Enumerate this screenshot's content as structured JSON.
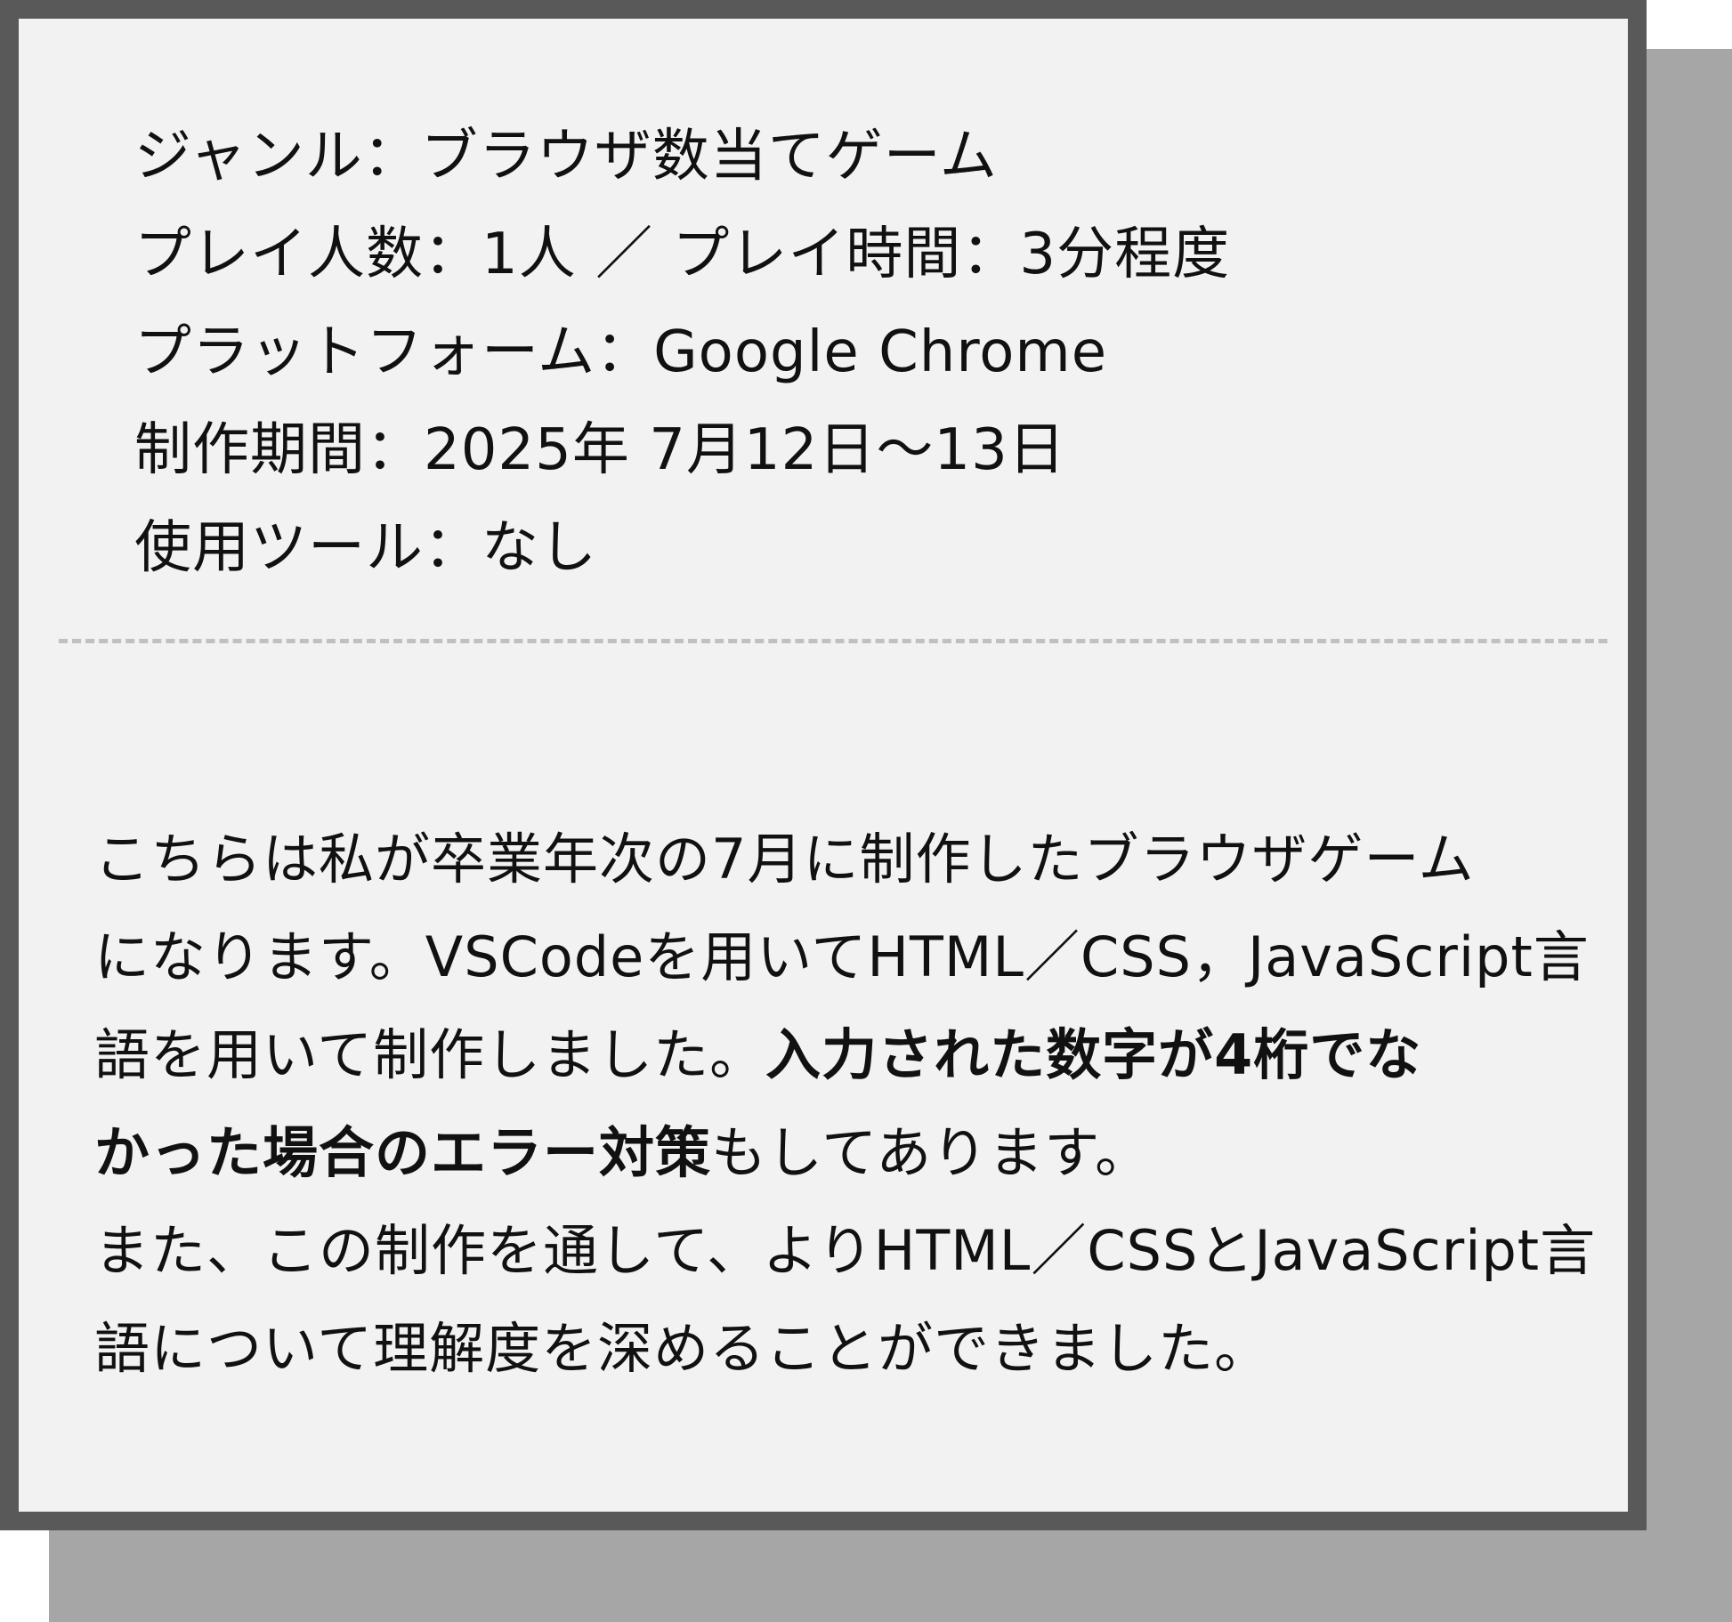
{
  "info": {
    "genre": "ジャンル：ブラウザ数当てゲーム",
    "players_time": "プレイ人数：1人 ／ プレイ時間：3分程度",
    "platform": "プラットフォーム：Google Chrome",
    "period": "制作期間：2025年 7月12日～13日",
    "tools": "使用ツール：なし"
  },
  "description": {
    "line1": "こちらは私が卒業年次の7月に制作したブラウザゲーム",
    "line2": "になります。VSCodeを用いてHTML／CSS，JavaScript言",
    "line3_normal": "語を用いて制作しました。",
    "line3_bold": "入力された数字が4桁でな",
    "line4_bold": "かった場合のエラー対策",
    "line4_normal": "もしてあります。",
    "line5": "また、この制作を通して、よりHTML／CSSとJavaScript言",
    "line6": "語について理解度を深めることができました。"
  }
}
